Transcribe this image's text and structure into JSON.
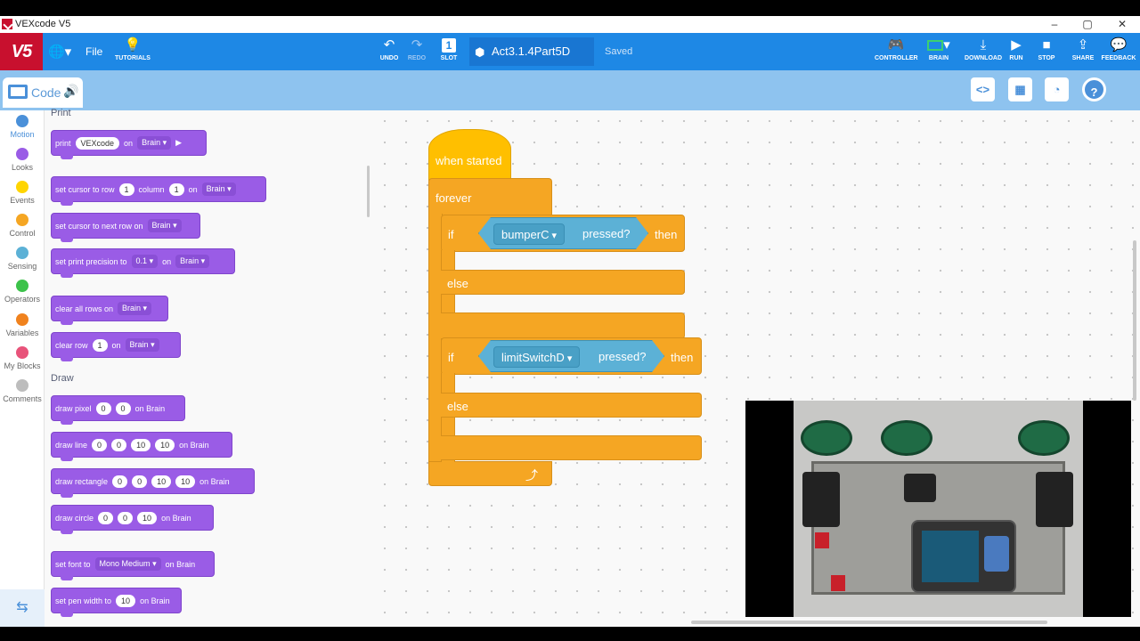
{
  "window": {
    "title": "VEXcode V5",
    "minimize": "–",
    "maximize": "▢",
    "close": "✕"
  },
  "toolbar": {
    "logo": "V5",
    "file": "File",
    "tutorials": "TUTORIALS",
    "undo": "UNDO",
    "redo": "REDO",
    "slot": "SLOT",
    "slot_number": "1",
    "project_name": "Act3.1.4Part5D",
    "save_status": "Saved",
    "controller": "CONTROLLER",
    "brain": "BRAIN",
    "download": "DOWNLOAD",
    "run": "RUN",
    "stop": "STOP",
    "share": "SHARE",
    "feedback": "FEEDBACK"
  },
  "code_tab": {
    "label": "Code"
  },
  "categories": [
    {
      "label": "Motion",
      "color": "#4a90d9"
    },
    {
      "label": "Looks",
      "color": "#9a5ce6"
    },
    {
      "label": "Events",
      "color": "#ffd500"
    },
    {
      "label": "Control",
      "color": "#f5a623"
    },
    {
      "label": "Sensing",
      "color": "#5cb1d6"
    },
    {
      "label": "Operators",
      "color": "#3cc24a"
    },
    {
      "label": "Variables",
      "color": "#f0821e"
    },
    {
      "label": "My Blocks",
      "color": "#e8537a"
    },
    {
      "label": "Comments",
      "color": "#bdbdbd"
    }
  ],
  "palette": {
    "print_header": "Print",
    "draw_header": "Draw",
    "print": {
      "label": "print",
      "text": "VEXcode",
      "on": "on",
      "target": "Brain"
    },
    "set_cursor": {
      "label": "set cursor to row",
      "row": "1",
      "column_label": "column",
      "column": "1",
      "on": "on",
      "target": "Brain"
    },
    "next_row": {
      "label": "set cursor to next row on",
      "target": "Brain"
    },
    "precision": {
      "label": "set print precision to",
      "value": "0.1",
      "on": "on",
      "target": "Brain"
    },
    "clear_all": {
      "label": "clear all rows on",
      "target": "Brain"
    },
    "clear_row": {
      "label": "clear row",
      "row": "1",
      "on": "on",
      "target": "Brain"
    },
    "draw_pixel": {
      "label": "draw pixel",
      "a": "0",
      "b": "0",
      "suffix": "on Brain"
    },
    "draw_line": {
      "label": "draw line",
      "a": "0",
      "b": "0",
      "c": "10",
      "d": "10",
      "suffix": "on Brain"
    },
    "draw_rect": {
      "label": "draw rectangle",
      "a": "0",
      "b": "0",
      "c": "10",
      "d": "10",
      "suffix": "on Brain"
    },
    "draw_circle": {
      "label": "draw circle",
      "a": "0",
      "b": "0",
      "c": "10",
      "suffix": "on Brain"
    },
    "set_font": {
      "label": "set font to",
      "font": "Mono Medium",
      "suffix": "on Brain"
    },
    "pen_width": {
      "label": "set pen width to",
      "value": "10",
      "suffix": "on Brain"
    }
  },
  "script": {
    "hat": "when started",
    "forever": "forever",
    "if1": {
      "if": "if",
      "sensor": "bumperC",
      "cond": "pressed?",
      "then": "then",
      "else": "else"
    },
    "if2": {
      "if": "if",
      "sensor": "limitSwitchD",
      "cond": "pressed?",
      "then": "then",
      "else": "else"
    }
  }
}
